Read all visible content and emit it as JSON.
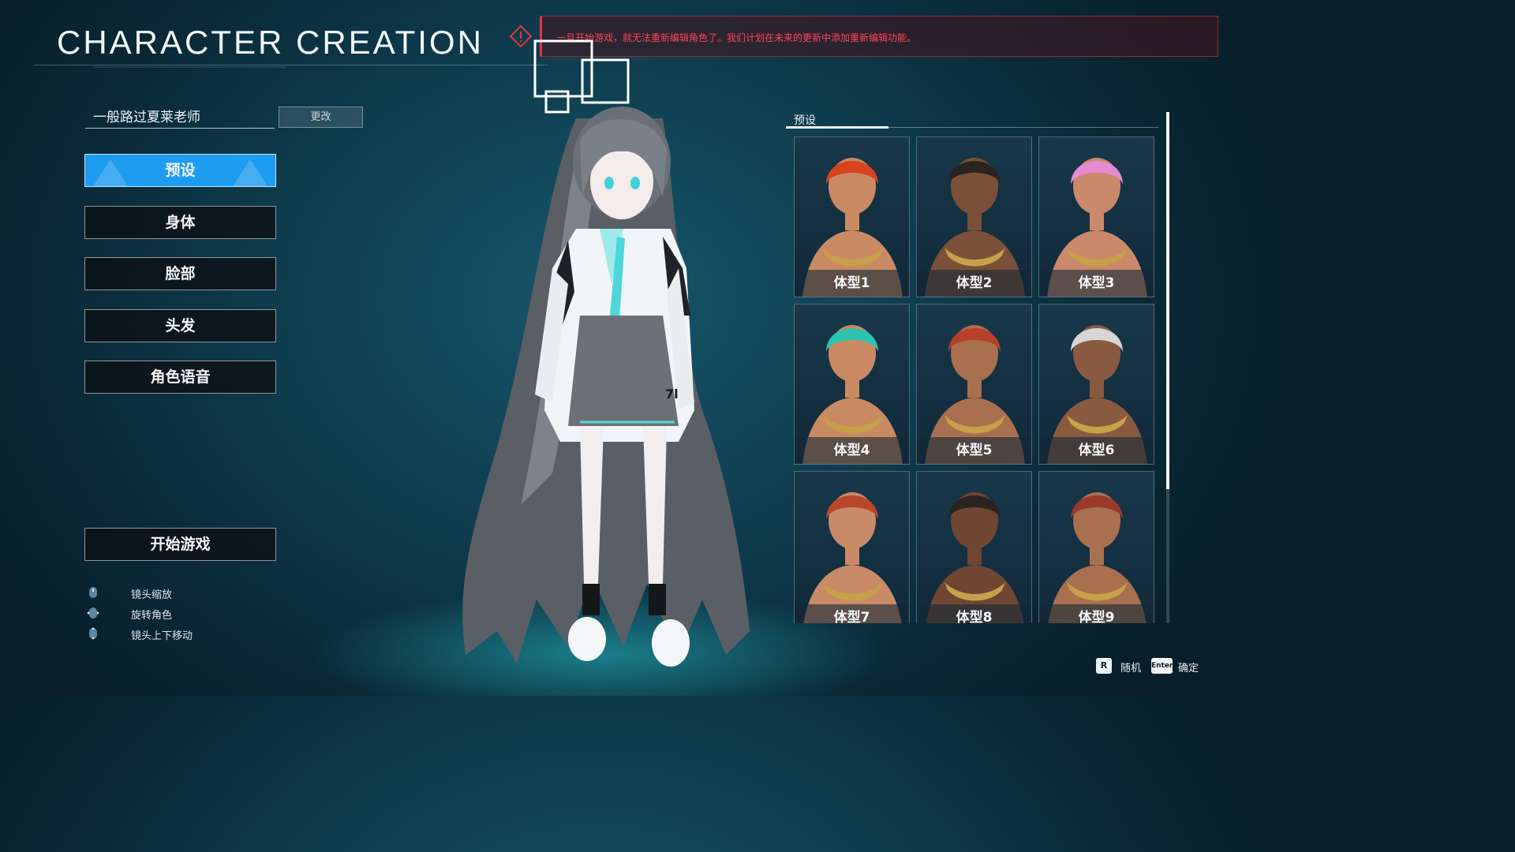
{
  "header": {
    "title": "CHARACTER CREATION"
  },
  "warning": {
    "text": "一旦开始游戏，就无法重新编辑角色了。我们计划在未来的更新中添加重新编辑功能。"
  },
  "name": {
    "value": "一般路过夏莱老师",
    "change_label": "更改"
  },
  "menu": {
    "items": [
      {
        "label": "预设",
        "active": true
      },
      {
        "label": "身体"
      },
      {
        "label": "脸部"
      },
      {
        "label": "头发"
      },
      {
        "label": "角色语音"
      }
    ],
    "start_label": "开始游戏"
  },
  "hints": [
    {
      "icon": "mouse-wheel-icon",
      "label": "镜头缩放"
    },
    {
      "icon": "mouse-drag-icon",
      "label": "旋转角色"
    },
    {
      "icon": "mouse-move-icon",
      "label": "镜头上下移动"
    }
  ],
  "presets": {
    "tab_label": "预设",
    "items": [
      {
        "label": "体型1",
        "hair": "#d8441f",
        "skin": "#c98a63"
      },
      {
        "label": "体型2",
        "hair": "#2a2420",
        "skin": "#7a5038"
      },
      {
        "label": "体型3",
        "hair": "#e58ad0",
        "skin": "#c9896a"
      },
      {
        "label": "体型4",
        "hair": "#2cc3b0",
        "skin": "#c98a63"
      },
      {
        "label": "体型5",
        "hair": "#b8402a",
        "skin": "#a8704e"
      },
      {
        "label": "体型6",
        "hair": "#d6d6d6",
        "skin": "#8a5a40"
      },
      {
        "label": "体型7",
        "hair": "#b8482a",
        "skin": "#c98a68"
      },
      {
        "label": "体型8",
        "hair": "#2a2420",
        "skin": "#6e4632"
      },
      {
        "label": "体型9",
        "hair": "#9a3a28",
        "skin": "#a8704e"
      }
    ]
  },
  "footer": {
    "random_key": "R",
    "random_label": "随机",
    "confirm_key": "Enter",
    "confirm_label": "确定"
  },
  "colors": {
    "accent": "#1e9cf0",
    "warning": "#ff4458"
  }
}
